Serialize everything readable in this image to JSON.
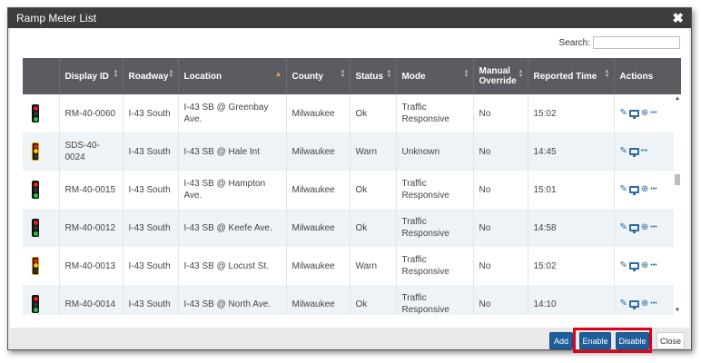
{
  "window": {
    "title": "Ramp Meter List",
    "close_glyph": "✖"
  },
  "search": {
    "label": "Search:",
    "value": ""
  },
  "columns": [
    {
      "label": "",
      "sort": ""
    },
    {
      "label": "Display ID",
      "sort": "none"
    },
    {
      "label": "Roadway",
      "sort": "none"
    },
    {
      "label": "Location",
      "sort": "asc"
    },
    {
      "label": "County",
      "sort": "none"
    },
    {
      "label": "Status",
      "sort": "none"
    },
    {
      "label": "Mode",
      "sort": "none"
    },
    {
      "label": "Manual Override",
      "sort": "none"
    },
    {
      "label": "Reported Time",
      "sort": "none"
    },
    {
      "label": "Actions",
      "sort": ""
    }
  ],
  "rows": [
    {
      "signal": "green",
      "display_id": "RM-40-0060",
      "roadway": "I-43 South",
      "location": "I-43 SB @ Greenbay Ave.",
      "county": "Milwaukee",
      "status": "Ok",
      "mode": "Traffic Responsive",
      "manual_override": "No",
      "reported_time": "15:02",
      "actions": [
        "edit-icon",
        "monitor-icon",
        "zoom-icon",
        "more-icon"
      ]
    },
    {
      "signal": "yellow",
      "display_id": "SDS-40-0024",
      "roadway": "I-43 South",
      "location": "I-43 SB @ Hale Int",
      "county": "Milwaukee",
      "status": "Warn",
      "mode": "Unknown",
      "manual_override": "No",
      "reported_time": "14:45",
      "actions": [
        "edit-icon",
        "monitor-icon",
        "more-icon"
      ]
    },
    {
      "signal": "green",
      "display_id": "RM-40-0015",
      "roadway": "I-43 South",
      "location": "I-43 SB @ Hampton Ave.",
      "county": "Milwaukee",
      "status": "Ok",
      "mode": "Traffic Responsive",
      "manual_override": "No",
      "reported_time": "15:01",
      "actions": [
        "edit-icon",
        "monitor-icon",
        "zoom-icon",
        "more-icon"
      ]
    },
    {
      "signal": "green",
      "display_id": "RM-40-0012",
      "roadway": "I-43 South",
      "location": "I-43 SB @ Keefe Ave.",
      "county": "Milwaukee",
      "status": "Ok",
      "mode": "Traffic Responsive",
      "manual_override": "No",
      "reported_time": "14:58",
      "actions": [
        "edit-icon",
        "monitor-icon",
        "zoom-icon",
        "more-icon"
      ]
    },
    {
      "signal": "yellow-amber",
      "display_id": "RM-40-0013",
      "roadway": "I-43 South",
      "location": "I-43 SB @ Locust St.",
      "county": "Milwaukee",
      "status": "Warn",
      "mode": "Traffic Responsive",
      "manual_override": "No",
      "reported_time": "15:02",
      "actions": [
        "edit-icon",
        "monitor-icon",
        "zoom-icon",
        "more-icon"
      ]
    },
    {
      "signal": "green",
      "display_id": "RM-40-0014",
      "roadway": "I-43 South",
      "location": "I-43 SB @ North Ave.",
      "county": "Milwaukee",
      "status": "Ok",
      "mode": "Traffic Responsive",
      "manual_override": "No",
      "reported_time": "14:10",
      "actions": [
        "edit-icon",
        "monitor-icon",
        "zoom-icon",
        "more-icon"
      ]
    }
  ],
  "footer": {
    "add_label": "Add",
    "enable_label": "Enable",
    "disable_label": "Disable",
    "close_label": "Close"
  },
  "colors": {
    "titlebar": "#3d3d40",
    "header": "#5b5c61",
    "primary_button": "#1f5d9b",
    "highlight": "#e3001b",
    "sort_active": "#f2a33a"
  }
}
